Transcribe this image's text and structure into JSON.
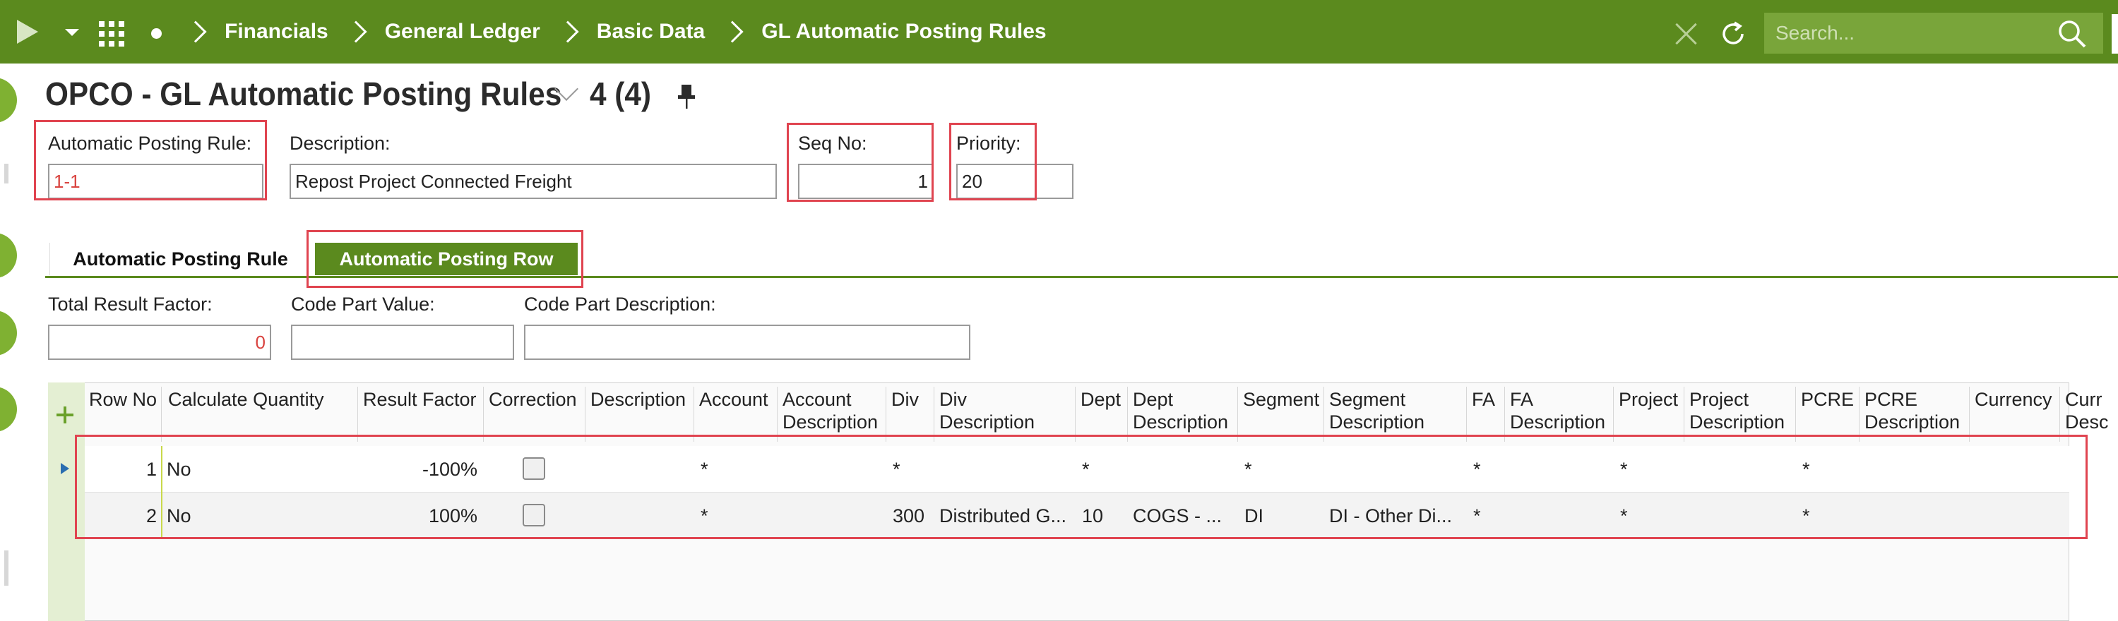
{
  "nav": {
    "breadcrumbs": [
      "Financials",
      "General Ledger",
      "Basic Data",
      "GL Automatic Posting Rules"
    ],
    "search_placeholder": "Search..."
  },
  "header": {
    "title": "OPCO - GL Automatic Posting Rules",
    "count": "4 (4)"
  },
  "form": {
    "rule_label": "Automatic Posting Rule:",
    "rule_value": "1-1",
    "description_label": "Description:",
    "description_value": "Repost Project Connected Freight",
    "seq_label": "Seq No:",
    "seq_value": "1",
    "priority_label": "Priority:",
    "priority_value": "20"
  },
  "tabs": [
    "Automatic Posting Rule",
    "Automatic Posting Row"
  ],
  "summary": {
    "total_factor_label": "Total Result Factor:",
    "total_factor_value": "0",
    "code_part_value_label": "Code Part Value:",
    "code_part_value": "",
    "code_part_desc_label": "Code Part Description:",
    "code_part_desc": ""
  },
  "table": {
    "headers": {
      "row_no": "Row No",
      "calc_qty": "Calculate Quantity",
      "result_factor": "Result Factor",
      "correction": "Correction",
      "description": "Description",
      "account": "Account",
      "account_desc_1": "Account",
      "account_desc_2": "Description",
      "div": "Div",
      "div_desc_1": "Div",
      "div_desc_2": "Description",
      "dept": "Dept",
      "dept_desc_1": "Dept",
      "dept_desc_2": "Description",
      "segment": "Segment",
      "segment_desc_1": "Segment",
      "segment_desc_2": "Description",
      "fa": "FA",
      "fa_desc_1": "FA",
      "fa_desc_2": "Description",
      "project": "Project",
      "project_desc_1": "Project",
      "project_desc_2": "Description",
      "pcre": "PCRE",
      "pcre_desc_1": "PCRE",
      "pcre_desc_2": "Description",
      "currency": "Currency",
      "curr_desc_1": "Curr",
      "curr_desc_2": "Desc"
    },
    "rows": [
      {
        "row_no": "1",
        "calc_qty": "No",
        "result_factor": "-100%",
        "account": "*",
        "div": "*",
        "div_desc": "",
        "dept": "*",
        "dept_desc": "",
        "segment": "*",
        "segment_desc": "",
        "fa": "*",
        "project": "*",
        "pcre": "*"
      },
      {
        "row_no": "2",
        "calc_qty": "No",
        "result_factor": "100%",
        "account": "*",
        "div": "300",
        "div_desc": "Distributed G...",
        "dept": "10",
        "dept_desc": "COGS - ...",
        "segment": "DI",
        "segment_desc": "DI - Other Di...",
        "fa": "*",
        "project": "*",
        "pcre": "*"
      }
    ]
  },
  "colors": {
    "brand_green": "#5b8a1e",
    "highlight_red": "#e04450",
    "value_red": "#d9433f"
  }
}
